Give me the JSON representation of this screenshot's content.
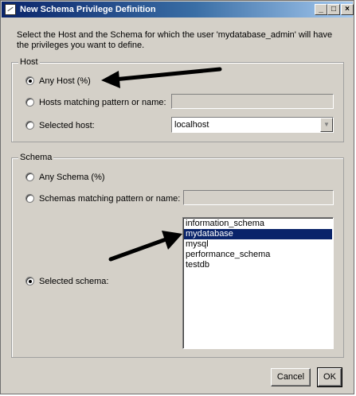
{
  "window": {
    "title": "New Schema Privilege Definition",
    "controls": {
      "minimize": "_",
      "maximize": "□",
      "close": "×"
    }
  },
  "intro_text": "Select the Host and the Schema for which the user 'mydatabase_admin' will have the privileges you want to define.",
  "host_group": {
    "legend": "Host",
    "options": {
      "any": {
        "label": "Any Host (%)",
        "checked": true
      },
      "pattern": {
        "label": "Hosts matching pattern or name:",
        "value": ""
      },
      "selected": {
        "label": "Selected host:"
      }
    },
    "selected_host_value": "localhost"
  },
  "schema_group": {
    "legend": "Schema",
    "options": {
      "any": {
        "label": "Any Schema (%)"
      },
      "pattern": {
        "label": "Schemas matching pattern or name:",
        "value": ""
      },
      "selected": {
        "label": "Selected schema:",
        "checked": true
      }
    },
    "schemas": [
      "information_schema",
      "mydatabase",
      "mysql",
      "performance_schema",
      "testdb"
    ],
    "selected_schema": "mydatabase"
  },
  "buttons": {
    "cancel": "Cancel",
    "ok": "OK"
  },
  "colors": {
    "selection": "#0a246a",
    "dialog": "#d4d0c8"
  },
  "icons": [
    "app-icon",
    "chevron-down-icon"
  ]
}
